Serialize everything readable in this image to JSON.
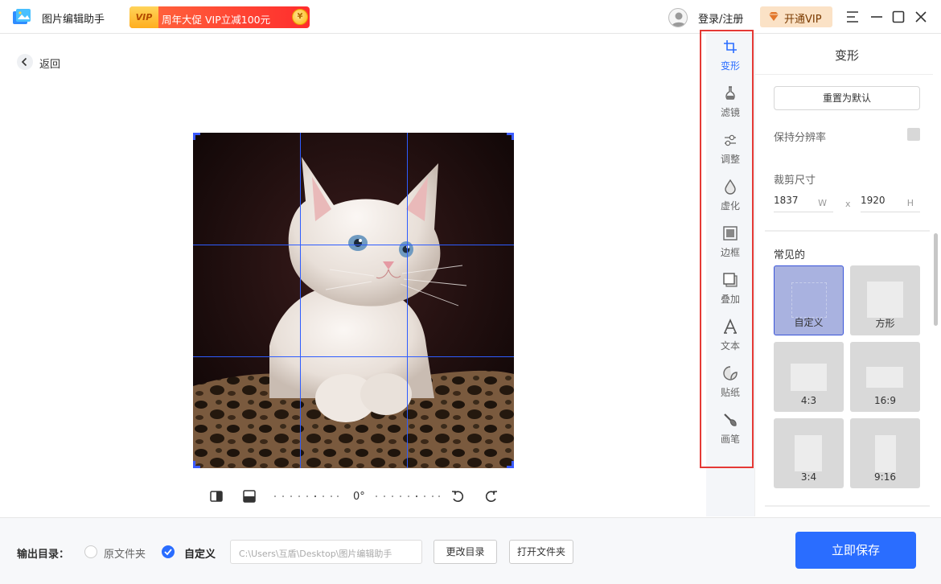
{
  "app": {
    "name": "图片编辑助手",
    "promo_badge": "VIP",
    "promo_text": "周年大促 VIP立减100元",
    "promo_coin": "¥"
  },
  "header": {
    "login_label": "登录/注册",
    "vip_label": "开通VIP",
    "icons": [
      "user-avatar-icon",
      "diamond-icon",
      "menu-icon",
      "minimize-icon",
      "maximize-icon",
      "close-icon"
    ]
  },
  "canvas": {
    "back_label": "返回",
    "rotation_angle": "0°",
    "image_subject": "white kitten",
    "crop_grid_color": "#2e5cff"
  },
  "tools": [
    {
      "label": "变形",
      "icon": "crop-icon",
      "active": true
    },
    {
      "label": "滤镜",
      "icon": "filter-flask-icon",
      "active": false
    },
    {
      "label": "调整",
      "icon": "adjust-sliders-icon",
      "active": false
    },
    {
      "label": "虚化",
      "icon": "blur-drop-icon",
      "active": false
    },
    {
      "label": "边框",
      "icon": "frame-icon",
      "active": false
    },
    {
      "label": "叠加",
      "icon": "overlay-icon",
      "active": false
    },
    {
      "label": "文本",
      "icon": "text-icon",
      "active": false
    },
    {
      "label": "贴纸",
      "icon": "sticker-icon",
      "active": false
    },
    {
      "label": "画笔",
      "icon": "brush-icon",
      "active": false
    }
  ],
  "panel": {
    "title": "变形",
    "reset_label": "重置为默认",
    "keep_resolution_label": "保持分辨率",
    "crop_size_label": "裁剪尺寸",
    "width_value": "1837",
    "width_unit": "W",
    "separator": "x",
    "height_value": "1920",
    "height_unit": "H",
    "common_label": "常见的",
    "ratios": [
      {
        "label": "自定义",
        "selected": true
      },
      {
        "label": "方形",
        "selected": false
      },
      {
        "label": "4:3",
        "selected": false
      },
      {
        "label": "16:9",
        "selected": false
      },
      {
        "label": "3:4",
        "selected": false
      },
      {
        "label": "9:16",
        "selected": false
      }
    ]
  },
  "footer": {
    "output_label": "输出目录：",
    "option_original": "原文件夹",
    "option_custom": "自定义",
    "path_value": "C:\\Users\\互盾\\Desktop\\图片编辑助手",
    "change_dir_label": "更改目录",
    "open_folder_label": "打开文件夹",
    "save_label": "立即保存"
  },
  "colors": {
    "accent": "#2a6dff",
    "highlight_outline": "#e53935",
    "vip_bg": "#fbe2c6"
  }
}
